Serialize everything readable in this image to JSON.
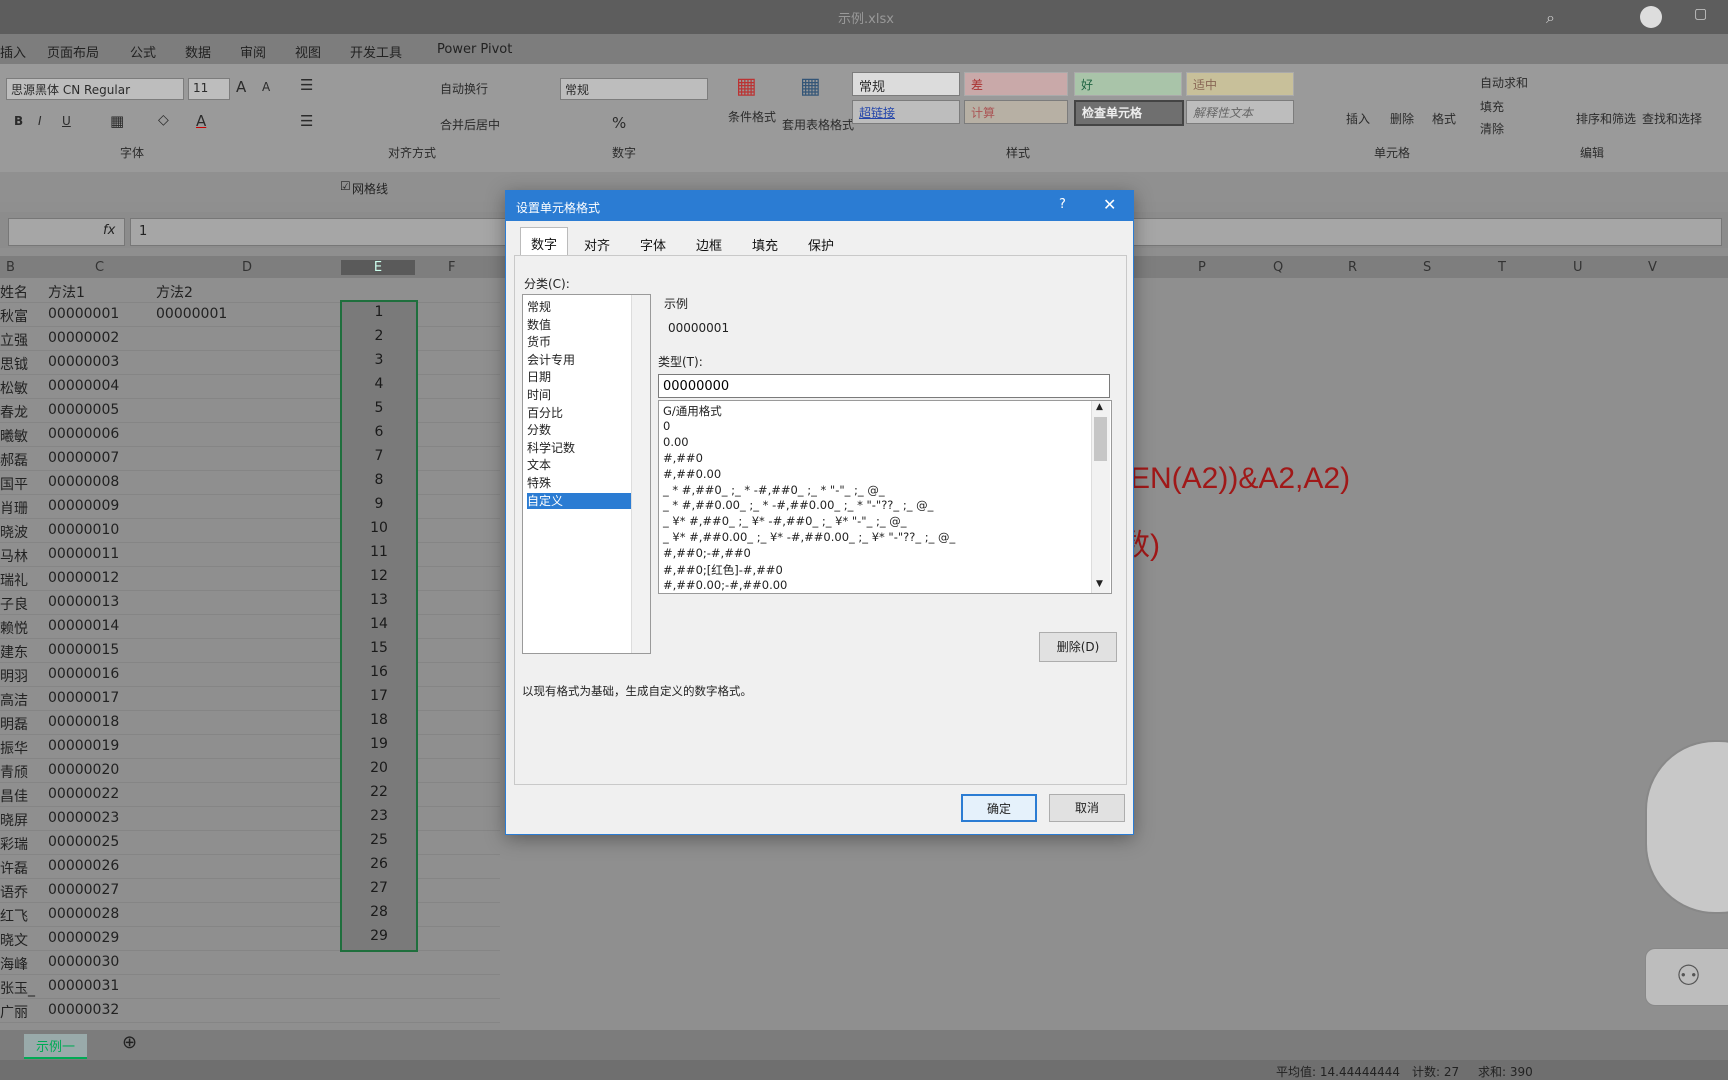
{
  "window": {
    "title": "示例.xlsx"
  },
  "ribbon_tabs": [
    "插入",
    "页面布局",
    "公式",
    "数据",
    "审阅",
    "视图",
    "开发工具",
    "Power Pivot"
  ],
  "ribbon": {
    "font_name": "思源黑体 CN Regular",
    "font_size": "11",
    "wrap_text": "自动换行",
    "merge_center": "合并后居中",
    "number_format": "常规",
    "cond_format": "条件格式",
    "table_format": "套用表格格式",
    "styles": {
      "normal": "常规",
      "bad": "差",
      "good": "好",
      "neutral": "适中",
      "hyperlink": "超链接",
      "calc": "计算",
      "check": "检查单元格",
      "explain": "解释性文本"
    },
    "cells": {
      "insert": "插入",
      "delete": "删除",
      "format": "格式"
    },
    "edit": {
      "autosum": "自动求和",
      "fill": "填充",
      "clear": "清除",
      "sort": "排序和筛选",
      "find": "查找和选择"
    },
    "groups": {
      "font": "字体",
      "align": "对齐方式",
      "number": "数字",
      "styles": "样式",
      "cells": "单元格",
      "edit": "编辑"
    },
    "gridlines": "网格线"
  },
  "formula_bar": {
    "value": "1"
  },
  "columns": [
    "B",
    "C",
    "D",
    "E",
    "F",
    "P",
    "Q",
    "R",
    "S",
    "T",
    "U",
    "V"
  ],
  "sheet": {
    "header": {
      "b": "姓名",
      "c": "方法1",
      "d": "方法2"
    },
    "d2": "00000001",
    "rows": [
      {
        "name": "秋富",
        "id": "00000001"
      },
      {
        "name": "立强",
        "id": "00000002"
      },
      {
        "name": "思钺",
        "id": "00000003"
      },
      {
        "name": "松敏",
        "id": "00000004"
      },
      {
        "name": "春龙",
        "id": "00000005"
      },
      {
        "name": "曦敏",
        "id": "00000006"
      },
      {
        "name": "郝磊",
        "id": "00000007"
      },
      {
        "name": "国平",
        "id": "00000008"
      },
      {
        "name": "肖珊",
        "id": "00000009"
      },
      {
        "name": "晓波",
        "id": "00000010"
      },
      {
        "name": "马林",
        "id": "00000011"
      },
      {
        "name": "瑞礼",
        "id": "00000012"
      },
      {
        "name": "子良",
        "id": "00000013"
      },
      {
        "name": "赖悦",
        "id": "00000014"
      },
      {
        "name": "建东",
        "id": "00000015"
      },
      {
        "name": "明羽",
        "id": "00000016"
      },
      {
        "name": "高洁",
        "id": "00000017"
      },
      {
        "name": "明磊",
        "id": "00000018"
      },
      {
        "name": "振华",
        "id": "00000019"
      },
      {
        "name": "青颀",
        "id": "00000020"
      },
      {
        "name": "昌佳",
        "id": "00000022"
      },
      {
        "name": "晓屏",
        "id": "00000023"
      },
      {
        "name": "彩瑞",
        "id": "00000025"
      },
      {
        "name": "许磊",
        "id": "00000026"
      },
      {
        "name": "语乔",
        "id": "00000027"
      },
      {
        "name": "红飞",
        "id": "00000028"
      },
      {
        "name": "晓文",
        "id": "00000029"
      },
      {
        "name": "海峰",
        "id": "00000030"
      },
      {
        "name": "张玉_",
        "id": "00000031"
      },
      {
        "name": "广丽",
        "id": "00000032"
      }
    ],
    "selected": [
      "1",
      "2",
      "3",
      "4",
      "5",
      "6",
      "7",
      "8",
      "9",
      "10",
      "11",
      "12",
      "13",
      "14",
      "15",
      "16",
      "17",
      "18",
      "19",
      "20",
      "22",
      "23",
      "25",
      "26",
      "27",
      "28",
      "29"
    ],
    "formula_frag1": "EN(A2))&A2,A2)",
    "formula_frag2": "数)"
  },
  "sheet_tab": "示例一",
  "status": {
    "avg": "平均值: 14.44444444",
    "count": "计数: 27",
    "sum": "求和: 390"
  },
  "dialog": {
    "title": "设置单元格格式",
    "help": "?",
    "close": "✕",
    "tabs": [
      "数字",
      "对齐",
      "字体",
      "边框",
      "填充",
      "保护"
    ],
    "category_label": "分类(C):",
    "categories": [
      "常规",
      "数值",
      "货币",
      "会计专用",
      "日期",
      "时间",
      "百分比",
      "分数",
      "科学记数",
      "文本",
      "特殊",
      "自定义"
    ],
    "selected_category": "自定义",
    "sample_label": "示例",
    "sample_value": "00000001",
    "type_label": "类型(T):",
    "type_value": "00000000",
    "formats": [
      "G/通用格式",
      "0",
      "0.00",
      "#,##0",
      "#,##0.00",
      "_ * #,##0_ ;_ * -#,##0_ ;_ * \"-\"_ ;_ @_",
      "_ * #,##0.00_ ;_ * -#,##0.00_ ;_ * \"-\"??_ ;_ @_",
      "_ ¥* #,##0_ ;_ ¥* -#,##0_ ;_ ¥* \"-\"_ ;_ @_",
      "_ ¥* #,##0.00_ ;_ ¥* -#,##0.00_ ;_ ¥* \"-\"??_ ;_ @_",
      "#,##0;-#,##0",
      "#,##0;[红色]-#,##0",
      "#,##0.00;-#,##0.00"
    ],
    "delete_btn": "删除(D)",
    "description": "以现有格式为基础，生成自定义的数字格式。",
    "ok": "确定",
    "cancel": "取消"
  }
}
